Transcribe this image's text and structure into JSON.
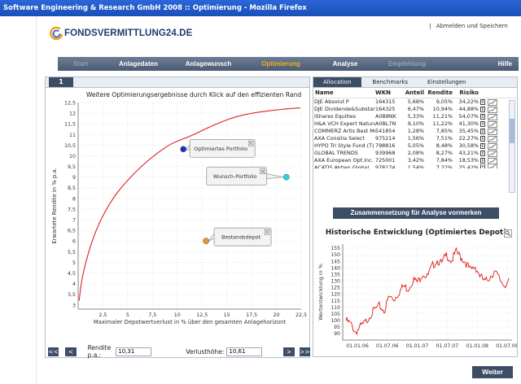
{
  "window": {
    "title": "Software Engineering & Research GmbH 2008 :: Optimierung - Mozilla Firefox"
  },
  "header": {
    "logo_text": "FONDSVERMITTLUNG24.DE",
    "links": [
      "|",
      "Abmelden und Speichern"
    ]
  },
  "nav": {
    "items": [
      {
        "label": "Start",
        "state": "disabled"
      },
      {
        "label": "Anlagedaten",
        "state": "normal"
      },
      {
        "label": "Anlagewunsch",
        "state": "normal"
      },
      {
        "label": "Optimierung",
        "state": "active"
      },
      {
        "label": "Analyse",
        "state": "normal"
      },
      {
        "label": "Empfehlung",
        "state": "disabled"
      },
      {
        "label": "Hilfe",
        "state": "normal"
      }
    ]
  },
  "left": {
    "tab": "1",
    "bottom": {
      "first": "<<",
      "prev": "<",
      "rendite_label": "Rendite p.a.:",
      "rendite_value": "10,31",
      "verlust_label": "Verlusthöhe:",
      "verlust_value": "10,61",
      "next": ">",
      "last": ">>"
    }
  },
  "right": {
    "tabs": [
      "Allocation",
      "Benchmarks",
      "Einstellungen"
    ],
    "table": {
      "columns": [
        "Name",
        "WKN",
        "Anteil",
        "Rendite",
        "Risiko"
      ],
      "rows": [
        [
          "DJE Absolut P",
          "164315",
          "5,68%",
          "9,05%",
          "34,22%"
        ],
        [
          "DJE Dividende&Substanz P",
          "164325",
          "6,47%",
          "10,94%",
          "44,88%"
        ],
        [
          "iShares Equities",
          "A0B8NK",
          "5,33%",
          "11,21%",
          "54,07%"
        ],
        [
          "H&A VCH Expert Natural R.",
          "A0BL7N",
          "9,10%",
          "11,22%",
          "41,30%"
        ],
        [
          "COMMERZ Artis Best Momen",
          "541854",
          "1,28%",
          "7,85%",
          "35,45%"
        ],
        [
          "AXA Consilia Select",
          "975214",
          "1,56%",
          "7,51%",
          "22,27%"
        ],
        [
          "HYPO Tri Style Fund (T)",
          "798816",
          "5,05%",
          "8,48%",
          "30,58%"
        ],
        [
          "GLOBAL TRENDS",
          "939968",
          "2,08%",
          "8,27%",
          "43,21%"
        ],
        [
          "AXA European Opt.inc. A",
          "725001",
          "3,42%",
          "7,84%",
          "18,53%"
        ],
        [
          "ACATIS Aktien Global",
          "978174",
          "1,54%",
          "7,22%",
          "25,42%"
        ]
      ]
    },
    "button": "Zusammensetzung für Analyse vormerken",
    "history_title": "Historische Entwicklung (Optimiertes Depot)"
  },
  "weiter": "Weiter",
  "chart_data": [
    {
      "type": "line",
      "title": "Weitere Optimierungsergebnisse durch Klick auf den effizienten Rand",
      "xlabel": "Maximaler Depotwertverlust in % über den gesamten Anlagehorizont",
      "ylabel": "Erwartete Rendite in % p.a.",
      "xlim": [
        0,
        22.5
      ],
      "ylim": [
        2.8,
        12.5
      ],
      "x_ticks": [
        "2,5",
        "5",
        "7,5",
        "10",
        "12,5",
        "15",
        "17,5",
        "20",
        "22,5"
      ],
      "y_ticks": [
        "3",
        "3,5",
        "4",
        "4,5",
        "5",
        "5,5",
        "6",
        "6,5",
        "7",
        "7,5",
        "8",
        "8,5",
        "9",
        "9,5",
        "10",
        "10,5",
        "11",
        "11,5",
        "12",
        "12,5"
      ],
      "grid": true,
      "series": [
        {
          "values": [
            [
              0.1,
              3.2
            ],
            [
              0.3,
              4.0
            ],
            [
              0.7,
              4.9
            ],
            [
              1.2,
              5.7
            ],
            [
              1.8,
              6.5
            ],
            [
              2.5,
              7.2
            ],
            [
              3.5,
              8.0
            ],
            [
              4.5,
              8.6
            ],
            [
              5.5,
              9.1
            ],
            [
              6.5,
              9.55
            ],
            [
              7.5,
              9.95
            ],
            [
              8.5,
              10.3
            ],
            [
              9.5,
              10.6
            ],
            [
              10.6,
              10.31
            ],
            [
              11.5,
              10.95
            ],
            [
              13,
              11.3
            ],
            [
              14.5,
              11.6
            ],
            [
              16,
              11.85
            ],
            [
              17.5,
              12.0
            ],
            [
              19,
              12.1
            ],
            [
              20,
              12.15
            ],
            [
              21,
              12.2
            ],
            [
              22.4,
              12.25
            ]
          ]
        }
      ],
      "points": [
        {
          "label": "Optimiertes Portfolio",
          "x": 10.61,
          "y": 10.31,
          "color": "#1f2fbf"
        },
        {
          "label": "Wunsch-Portfolio",
          "x": 21,
          "y": 9.0,
          "color": "#27d5e8"
        },
        {
          "label": "Bestandsdepot",
          "x": 12.9,
          "y": 6.0,
          "color": "#e39a30"
        }
      ]
    },
    {
      "type": "line",
      "title": "Historische Entwicklung (Optimiertes Depot)",
      "ylabel": "Wertentwicklung in %",
      "ylim": [
        85,
        158
      ],
      "y_ticks": [
        "90",
        "95",
        "100",
        "105",
        "110",
        "115",
        "120",
        "125",
        "130",
        "135",
        "140",
        "145",
        "150",
        "155"
      ],
      "x_ticks": [
        "01.01.06",
        "01.07.06",
        "01.01.07",
        "01.07.07",
        "01.01.08",
        "01.07.08"
      ],
      "grid": true,
      "values": [
        100,
        97,
        91,
        95,
        98,
        104,
        108,
        111,
        107,
        118,
        116,
        121,
        126,
        124,
        131,
        129,
        136,
        133,
        141,
        146,
        143,
        150,
        145,
        152,
        148,
        144,
        138,
        141,
        134,
        129,
        133,
        137,
        132,
        127,
        129
      ]
    }
  ]
}
